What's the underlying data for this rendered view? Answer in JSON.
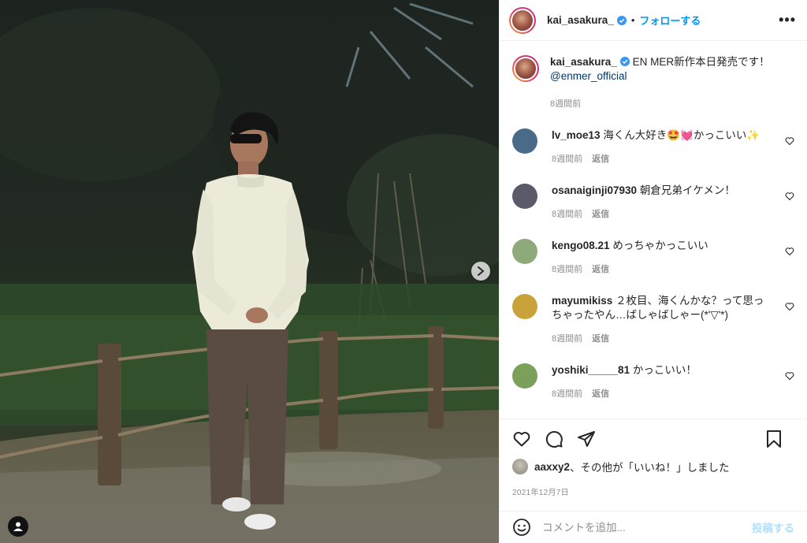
{
  "header": {
    "username": "kai_asakura_",
    "separator": "•",
    "follow_label": "フォローする",
    "more_label": "•••"
  },
  "caption": {
    "username": "kai_asakura_",
    "text": "EN MER新作本日発売です！",
    "mention": "@enmer_official",
    "time": "8週間前"
  },
  "comments": [
    {
      "username": "lv_moe13",
      "text": "海くん大好き🤩💓かっこいい✨",
      "time": "8週間前",
      "reply": "返信",
      "avatar_color": "#4a6a8a"
    },
    {
      "username": "osanaiginji07930",
      "text": "朝倉兄弟イケメン！",
      "time": "8週間前",
      "reply": "返信",
      "avatar_color": "#5a5a6a"
    },
    {
      "username": "kengo08.21",
      "text": "めっちゃかっこいい",
      "time": "8週間前",
      "reply": "返信",
      "avatar_color": "#8faa7a"
    },
    {
      "username": "mayumikiss",
      "text": "２枚目、海くんかな？って思っちゃったやん…ばしゃばしゃー(*'▽'*)",
      "time": "8週間前",
      "reply": "返信",
      "avatar_color": "#c9a23a"
    },
    {
      "username": "yoshiki_____81",
      "text": "かっこいい！",
      "time": "8週間前",
      "reply": "返信",
      "avatar_color": "#7aa05a"
    }
  ],
  "likes": {
    "text_user": "aaxxy2",
    "text_rest": "、その他が「いいね！」しました"
  },
  "post_date": "2021年12月7日",
  "add_comment": {
    "placeholder": "コメントを追加...",
    "post_label": "投稿する"
  },
  "colors": {
    "accent": "#0095f6",
    "post_disabled": "#b2dffc",
    "muted": "#8e8e8e",
    "text": "#262626"
  }
}
